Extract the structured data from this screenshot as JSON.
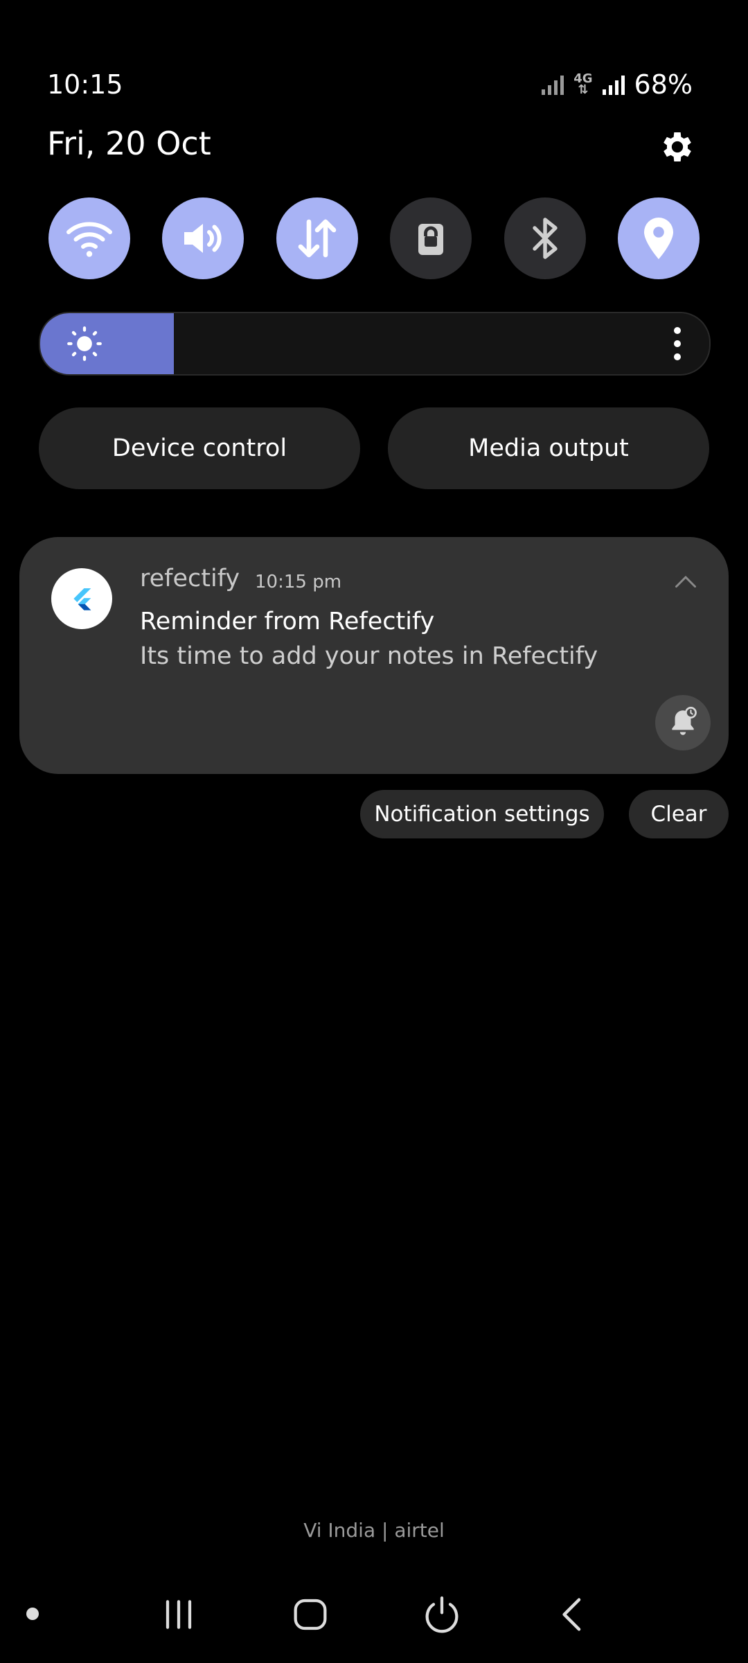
{
  "status_bar": {
    "time": "10:15",
    "network": "4G",
    "battery": "68%"
  },
  "header": {
    "date": "Fri, 20 Oct"
  },
  "quick_tiles": [
    {
      "name": "wifi",
      "state": "on"
    },
    {
      "name": "sound",
      "state": "on"
    },
    {
      "name": "mobile-data",
      "state": "on"
    },
    {
      "name": "screen-lock",
      "state": "off"
    },
    {
      "name": "bluetooth",
      "state": "off"
    },
    {
      "name": "location",
      "state": "on"
    }
  ],
  "brightness": {
    "level": 0.2
  },
  "controls": {
    "device_control": "Device control",
    "media_output": "Media output"
  },
  "notification": {
    "app_name": "refectify",
    "time": "10:15 pm",
    "title": "Reminder from Refectify",
    "body": "Its time to add your notes in Refectify"
  },
  "notification_actions": {
    "settings": "Notification settings",
    "clear": "Clear"
  },
  "carrier": "Vi India | airtel",
  "colors": {
    "accent": "#a8b3f5",
    "brightness_fill": "#6a76cf",
    "card": "#333333"
  }
}
